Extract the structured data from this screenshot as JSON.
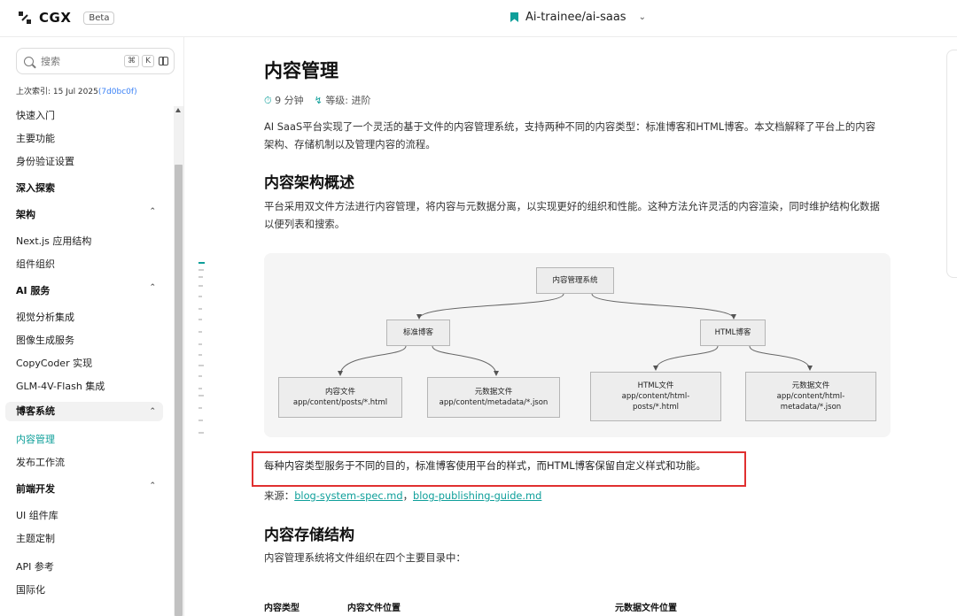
{
  "header": {
    "logo_text": "CGX",
    "beta_label": "Beta",
    "repo_name": "Ai-trainee/ai-saas",
    "accent": "#0e9f9a"
  },
  "sidebar": {
    "search": {
      "placeholder": "搜索",
      "shortcut_1": "⌘",
      "shortcut_2": "K"
    },
    "last_index_prefix": "上次索引: 15 Jul 2025",
    "last_index_hash": "(7d0bc0f)",
    "items": {
      "quickstart": "快速入门",
      "features": "主要功能",
      "auth": "身份验证设置",
      "deep_dive": "深入探索",
      "architecture": "架构",
      "nextjs": "Next.js 应用结构",
      "components": "组件组织",
      "ai_services": "AI 服务",
      "vision": "视觉分析集成",
      "image_gen": "图像生成服务",
      "copycoder": "CopyCoder 实现",
      "glm": "GLM-4V-Flash 集成",
      "blog_system": "博客系统",
      "content_mgmt": "内容管理",
      "publish_flow": "发布工作流",
      "frontend": "前端开发",
      "ui_lib": "UI 组件库",
      "theme": "主题定制",
      "api_ref": "API 参考",
      "i18n": "国际化"
    }
  },
  "main": {
    "title": "内容管理",
    "read_time": "9 分钟",
    "level": "等级: 进阶",
    "intro_line1": "AI SaaS平台实现了一个灵活的基于文件的内容管理系统，支持两种不同的内容类型：标准博客和HTML博客。本文档解释了平台上的内容",
    "intro_line2": "架构、存储机制以及管理内容的流程。",
    "h2_overview": "内容架构概述",
    "overview_line1": "平台采用双文件方法进行内容管理，将内容与元数据分离，以实现更好的组织和性能。这种方法允许灵活的内容渲染，同时维护结构化数据",
    "overview_line2": "以便列表和搜索。",
    "diagram": {
      "root": "内容管理系统",
      "std_blog": "标准博客",
      "html_blog": "HTML博客",
      "std_content_title": "内容文件",
      "std_content_path": "app/content/posts/*.html",
      "std_meta_title": "元数据文件",
      "std_meta_path": "app/content/metadata/*.json",
      "html_content_title": "HTML文件",
      "html_content_path_1": "app/content/html-",
      "html_content_path_2": "posts/*.html",
      "html_meta_title": "元数据文件",
      "html_meta_path_1": "app/content/html-",
      "html_meta_path_2": "metadata/*.json"
    },
    "highlight_text": "每种内容类型服务于不同的目的，标准博客使用平台的样式，而HTML博客保留自定义样式和功能。",
    "source_label": "来源：",
    "source_link_1": "blog-system-spec.md",
    "source_sep": "，",
    "source_link_2": "blog-publishing-guide.md",
    "h2_storage": "内容存储结构",
    "storage_text": "内容管理系统将文件组织在四个主要目录中：",
    "table_headers": [
      "内容类型",
      "内容文件位置",
      "元数据文件位置"
    ]
  }
}
